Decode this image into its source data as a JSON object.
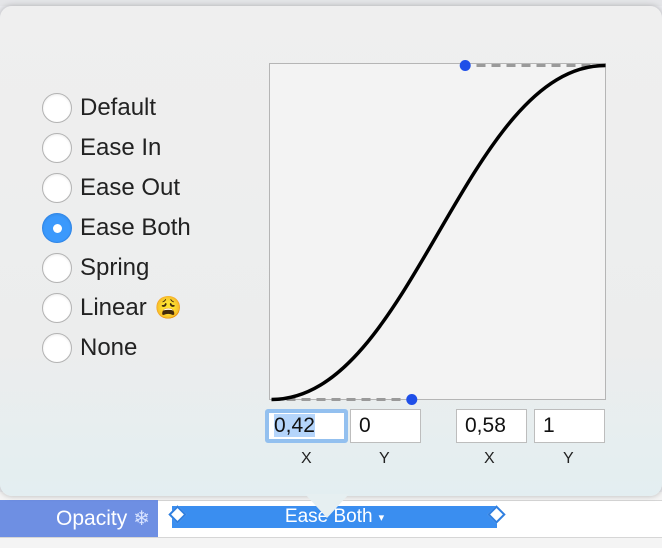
{
  "easing": {
    "options": [
      {
        "label": "Default",
        "checked": false
      },
      {
        "label": "Ease In",
        "checked": false
      },
      {
        "label": "Ease Out",
        "checked": false
      },
      {
        "label": "Ease Both",
        "checked": true
      },
      {
        "label": "Spring",
        "checked": false
      },
      {
        "label": "Linear",
        "checked": false,
        "emoji": "😩"
      },
      {
        "label": "None",
        "checked": false
      }
    ]
  },
  "bezier": {
    "p1": {
      "x": 0.42,
      "y": 0
    },
    "p2": {
      "x": 0.58,
      "y": 1
    },
    "fields": {
      "p1x": "0,42",
      "p1y": "0",
      "p2x": "0,58",
      "p2y": "1"
    },
    "labels": {
      "p1x": "X",
      "p1y": "Y",
      "p2x": "X",
      "p2y": "Y"
    }
  },
  "timeline": {
    "property_label": "Opacity",
    "property_icon": "snowflake-icon",
    "bar_label": "Ease Both",
    "bar_caret": "▾"
  },
  "colors": {
    "accent": "#3b99fc",
    "handle": "#1f4fe8",
    "timeline_bar": "#3a8ef0",
    "property_label_bg": "#6e8fe3"
  }
}
